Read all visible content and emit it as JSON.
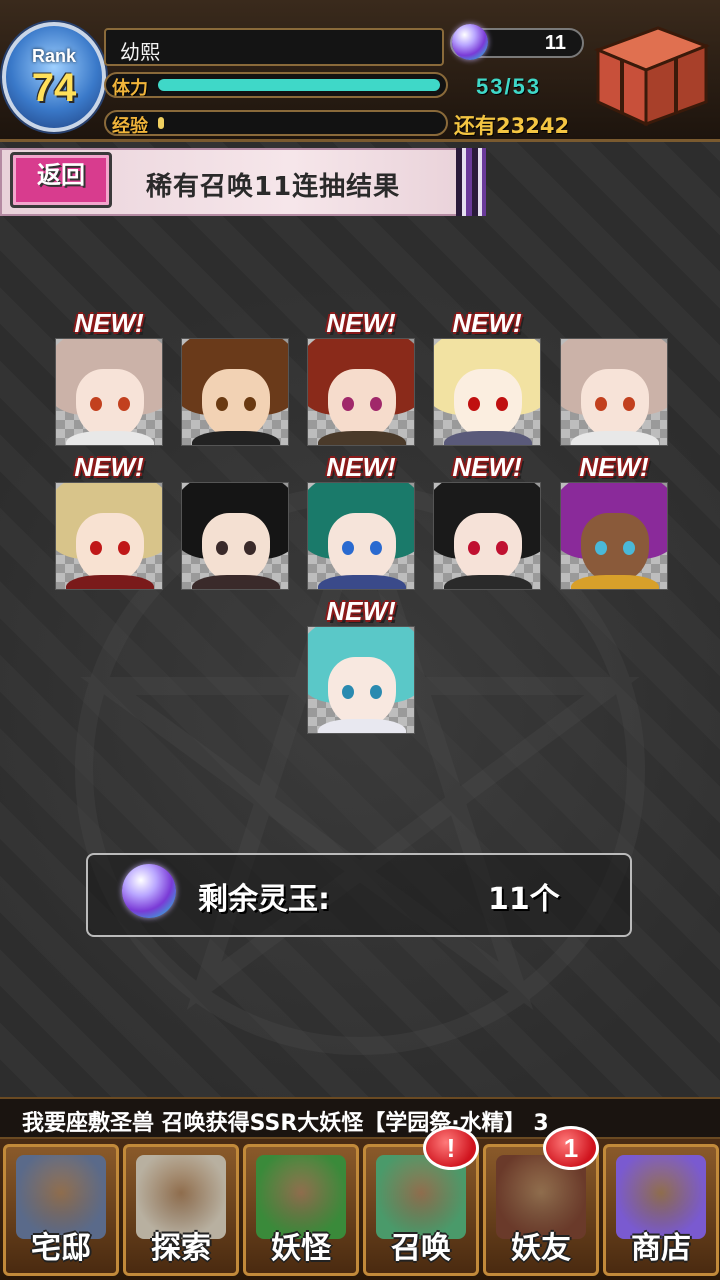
{
  "player": {
    "rank_label": "Rank",
    "rank": "74",
    "name": "幼熙",
    "gems": "11",
    "stamina_label": "体力",
    "stamina": "53/53",
    "stamina_fraction": 1.0,
    "exp_label": "经验",
    "exp_remaining": "还有23242",
    "exp_fraction": 0.02
  },
  "header": {
    "back_label": "返回",
    "title": "稀有召唤11连抽结果"
  },
  "results": {
    "new_label": "NEW!",
    "cards": [
      {
        "id": "card-1",
        "is_new": true,
        "hair": "#cbb2a8",
        "face": "#f7e3d8",
        "eye": "#c2401e",
        "body": "#e8e8e8"
      },
      {
        "id": "card-2",
        "is_new": false,
        "hair": "#6a3a1a",
        "face": "#f2d2b4",
        "eye": "#6a3a12",
        "body": "#222222"
      },
      {
        "id": "card-3",
        "is_new": true,
        "hair": "#8a2a1a",
        "face": "#f6dccc",
        "eye": "#a0286a",
        "body": "#4a3a2a"
      },
      {
        "id": "card-4",
        "is_new": true,
        "hair": "#f2e2a2",
        "face": "#fbeee0",
        "eye": "#c01010",
        "body": "#5a5a7a"
      },
      {
        "id": "card-5",
        "is_new": false,
        "hair": "#cbb2a8",
        "face": "#f7e3d8",
        "eye": "#c2401e",
        "body": "#e8e8e8"
      },
      {
        "id": "card-6",
        "is_new": true,
        "hair": "#d8c48a",
        "face": "#f8e2d2",
        "eye": "#c01818",
        "body": "#7a1a1a"
      },
      {
        "id": "card-7",
        "is_new": false,
        "hair": "#151515",
        "face": "#f4e0d2",
        "eye": "#3a2a2a",
        "body": "#3a2a2a"
      },
      {
        "id": "card-8",
        "is_new": true,
        "hair": "#1a7a6a",
        "face": "#f6e4da",
        "eye": "#2a6ad0",
        "body": "#3a4a8a"
      },
      {
        "id": "card-9",
        "is_new": true,
        "hair": "#1a1a1a",
        "face": "#f6e2d8",
        "eye": "#c01030",
        "body": "#2a2a2a"
      },
      {
        "id": "card-10",
        "is_new": true,
        "hair": "#8a2a9a",
        "face": "#8a5a3a",
        "eye": "#4ab8d8",
        "body": "#d8a02a"
      },
      {
        "id": "card-11",
        "is_new": true,
        "hair": "#5ac8c8",
        "face": "#f8e8e0",
        "eye": "#2a8ab0",
        "body": "#e8e8f0"
      }
    ]
  },
  "remaining": {
    "label": "剩余灵玉:",
    "value": "11个"
  },
  "ticker": {
    "text": "我要座敷圣兽 召唤获得SSR大妖怪【学园祭·水精】 3"
  },
  "nav": {
    "items": [
      {
        "id": "home",
        "label": "宅邸",
        "icon": "mansion-icon",
        "color": "#5a6a8a"
      },
      {
        "id": "explore",
        "label": "探索",
        "icon": "magnifier-icon",
        "color": "#b8b0a0"
      },
      {
        "id": "yokai",
        "label": "妖怪",
        "icon": "scroll-icon",
        "color": "#3a8a3a"
      },
      {
        "id": "summon",
        "label": "召唤",
        "icon": "star-icon",
        "color": "#4a9a6a",
        "badge": "!"
      },
      {
        "id": "friends",
        "label": "妖友",
        "icon": "fox-girl-icon",
        "color": "#6a3a2a",
        "badge": "1"
      },
      {
        "id": "shop",
        "label": "商店",
        "icon": "orb-icon",
        "color": "#7a5ad0"
      }
    ]
  },
  "colors": {
    "stamina_bar": "#3fd8c8",
    "exp_bar": "#f0d060",
    "accent_pink": "#d83c8e"
  }
}
